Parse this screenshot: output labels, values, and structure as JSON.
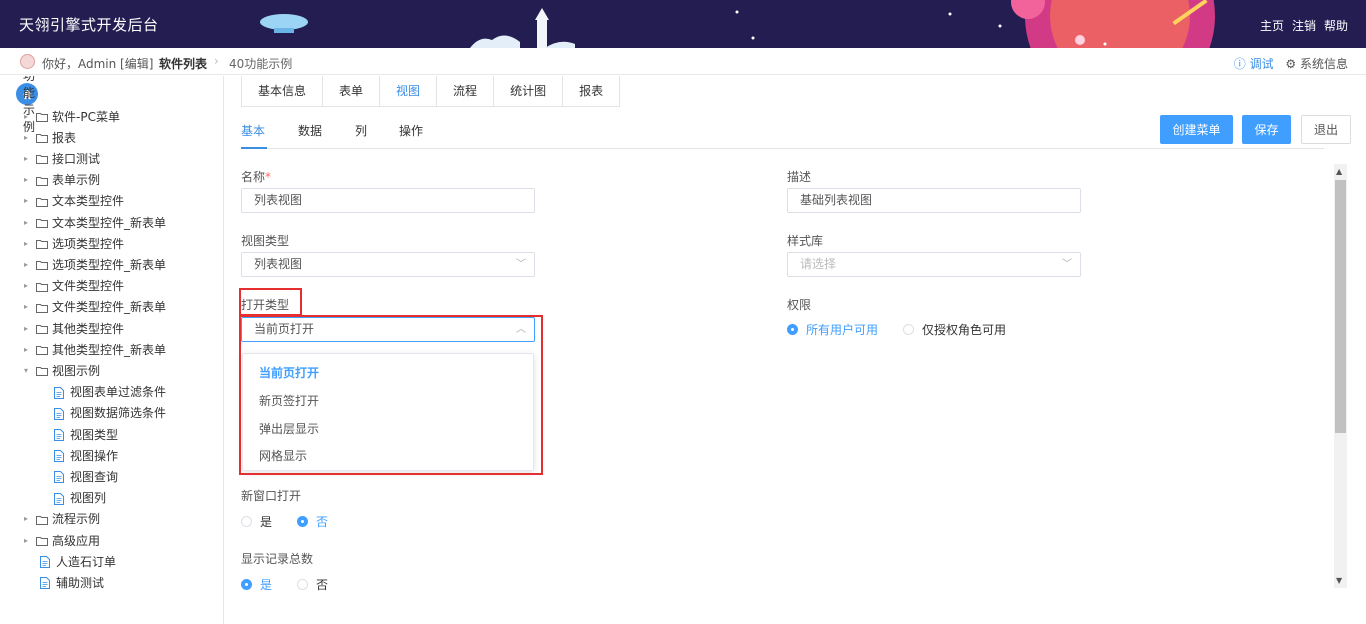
{
  "header": {
    "title": "天翎引擎式开发后台",
    "nav": [
      "主页",
      "注销",
      "帮助"
    ]
  },
  "crumbbar": {
    "greeting": "你好，Admin [编辑]",
    "crumb1": "软件列表",
    "crumb2": "40功能示例",
    "debug": "ⓘ 调试",
    "sysinfo": "⚙ 系统信息"
  },
  "sidebar": {
    "root": "40功能示例",
    "items": [
      {
        "label": "软件-PC菜单",
        "type": "folder",
        "arrow": "▸"
      },
      {
        "label": "报表",
        "type": "folder",
        "arrow": "▸"
      },
      {
        "label": "接口测试",
        "type": "folder",
        "arrow": "▸"
      },
      {
        "label": "表单示例",
        "type": "folder",
        "arrow": "▸"
      },
      {
        "label": "文本类型控件",
        "type": "folder",
        "arrow": "▸"
      },
      {
        "label": "文本类型控件_新表单",
        "type": "folder",
        "arrow": "▸"
      },
      {
        "label": "选项类型控件",
        "type": "folder",
        "arrow": "▸"
      },
      {
        "label": "选项类型控件_新表单",
        "type": "folder",
        "arrow": "▸"
      },
      {
        "label": "文件类型控件",
        "type": "folder",
        "arrow": "▸"
      },
      {
        "label": "文件类型控件_新表单",
        "type": "folder",
        "arrow": "▸"
      },
      {
        "label": "其他类型控件",
        "type": "folder",
        "arrow": "▸"
      },
      {
        "label": "其他类型控件_新表单",
        "type": "folder",
        "arrow": "▸"
      },
      {
        "label": "视图示例",
        "type": "folder-open",
        "arrow": "▾"
      },
      {
        "label": "视图表单过滤条件",
        "type": "file",
        "arrow": ""
      },
      {
        "label": "视图数据筛选条件",
        "type": "file",
        "arrow": ""
      },
      {
        "label": "视图类型",
        "type": "file",
        "arrow": ""
      },
      {
        "label": "视图操作",
        "type": "file",
        "arrow": ""
      },
      {
        "label": "视图查询",
        "type": "file",
        "arrow": ""
      },
      {
        "label": "视图列",
        "type": "file",
        "arrow": ""
      },
      {
        "label": "流程示例",
        "type": "folder",
        "arrow": "▸"
      },
      {
        "label": "高级应用",
        "type": "folder",
        "arrow": "▸"
      },
      {
        "label": "人造石订单",
        "type": "file",
        "arrow": ""
      },
      {
        "label": "辅助测试",
        "type": "file",
        "arrow": ""
      }
    ]
  },
  "tabs": [
    "基本信息",
    "表单",
    "视图",
    "流程",
    "统计图",
    "报表"
  ],
  "subtabs": [
    "基本",
    "数据",
    "列",
    "操作"
  ],
  "buttons": {
    "create_menu": "创建菜单",
    "save": "保存",
    "exit": "退出"
  },
  "form": {
    "name_label": "名称",
    "required_mark": "*",
    "name_value": "列表视图",
    "desc_label": "描述",
    "desc_value": "基础列表视图",
    "view_type_label": "视图类型",
    "view_type_value": "列表视图",
    "style_lib_label": "样式库",
    "style_lib_placeholder": "请选择",
    "open_type_label": "打开类型",
    "open_type_value": "当前页打开",
    "perm_label": "权限",
    "perm_opt1": "所有用户可用",
    "perm_opt2": "仅授权角色可用",
    "new_window_label": "新窗口打开",
    "new_window_yes": "是",
    "new_window_no": "否",
    "show_total_label": "显示记录总数",
    "show_total_yes": "是",
    "show_total_no": "否"
  },
  "dropdown_options": [
    "当前页打开",
    "新页签打开",
    "弹出层显示",
    "网格显示"
  ],
  "colors": {
    "accent": "#409eff",
    "header_bg": "#241d52",
    "highlight": "#e52f2f"
  }
}
